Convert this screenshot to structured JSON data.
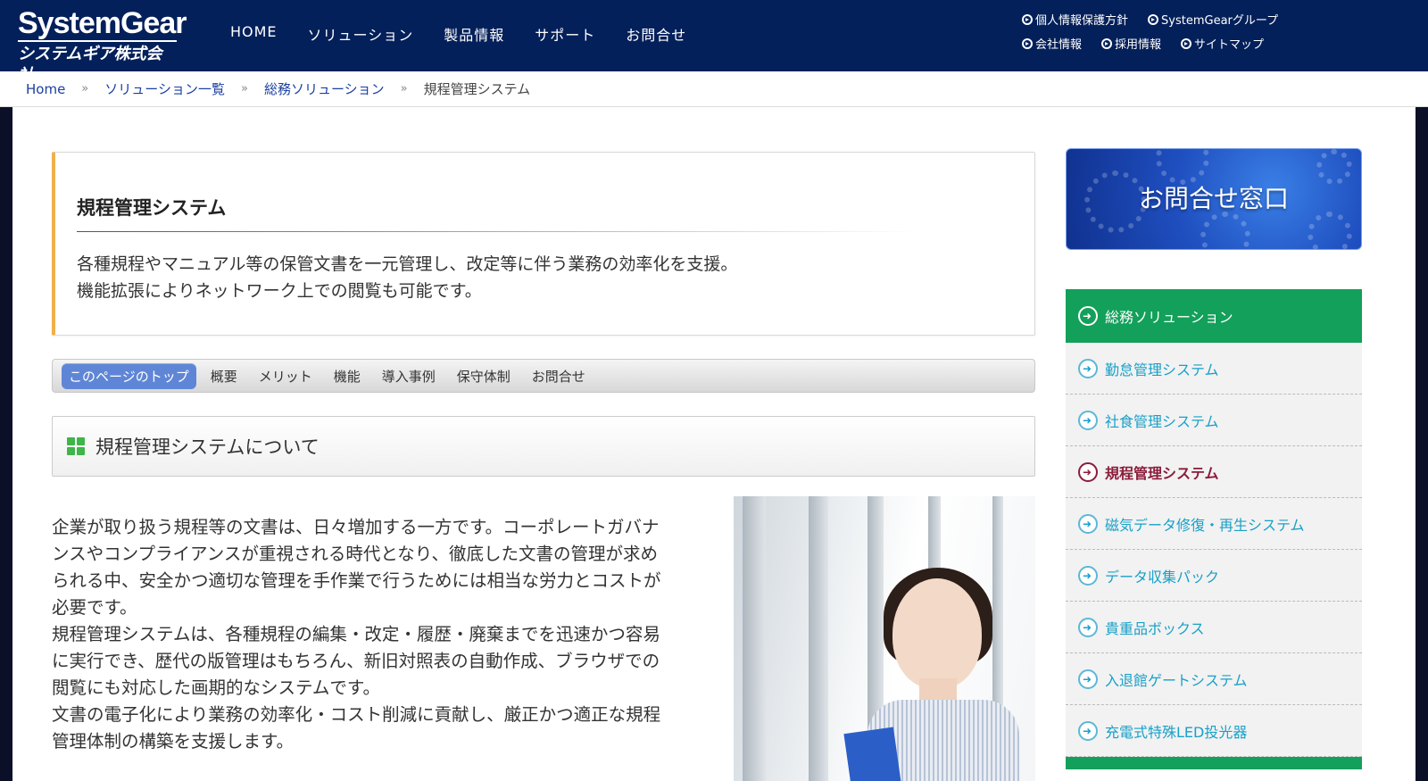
{
  "header": {
    "logo_en": "SystemGear",
    "logo_jp": "システムギア株式会社",
    "nav": [
      "HOME",
      "ソリューション",
      "製品情報",
      "サポート",
      "お問合せ"
    ],
    "util_row1": [
      "個人情報保護方針",
      "SystemGearグループ"
    ],
    "util_row2": [
      "会社情報",
      "採用情報",
      "サイトマップ"
    ]
  },
  "breadcrumb": {
    "items": [
      "Home",
      "ソリューション一覧",
      "総務ソリューション"
    ],
    "current": "規程管理システム",
    "separator": "»"
  },
  "intro": {
    "title": "規程管理システム",
    "line1": "各種規程やマニュアル等の保管文書を一元管理し、改定等に伴う業務の効率化を支援。",
    "line2": "機能拡張によりネットワーク上での閲覧も可能です。"
  },
  "page_tabs": {
    "active": "このページのトップ",
    "items": [
      "概要",
      "メリット",
      "機能",
      "導入事例",
      "保守体制",
      "お問合せ"
    ]
  },
  "section": {
    "title": "規程管理システムについて"
  },
  "body": {
    "lines": [
      "企業が取り扱う規程等の文書は、日々増加する一方です。コーポレートガバナ",
      "ンスやコンプライアンスが重視される時代となり、徹底した文書の管理が求め",
      "られる中、安全かつ適切な管理を手作業で行うためには相当な労力とコストが",
      "必要です。",
      "規程管理システムは、各種規程の編集・改定・履歴・廃棄までを迅速かつ容易",
      "に実行でき、歴代の版管理はもちろん、新旧対照表の自動作成、ブラウザでの",
      "閲覧にも対応した画期的なシステムです。",
      "文書の電子化により業務の効率化・コスト削減に貢献し、厳正かつ適正な規程",
      "管理体制の構築を支援します。"
    ]
  },
  "sidebar": {
    "contact_banner": "お問合せ窓口",
    "menu_head": "総務ソリューション",
    "items": [
      "勤怠管理システム",
      "社食管理システム",
      "規程管理システム",
      "磁気データ修復・再生システム",
      "データ収集パック",
      "貴重品ボックス",
      "入退館ゲートシステム",
      "充電式特殊LED投光器"
    ],
    "current_index": 2
  },
  "colors": {
    "header_bg": "#04205a",
    "accent_orange": "#f1b04a",
    "menu_green": "#13a05a",
    "link_blue": "#1a3fa0",
    "current_item": "#8b1c3a"
  }
}
